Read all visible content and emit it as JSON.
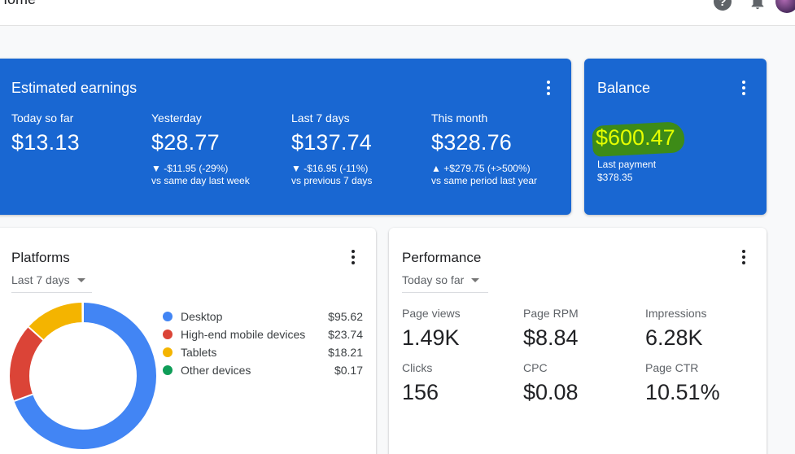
{
  "header": {
    "title": "Home"
  },
  "estimated_earnings": {
    "title": "Estimated earnings",
    "periods": [
      {
        "label": "Today so far",
        "value": "$13.13",
        "delta": "",
        "compare": ""
      },
      {
        "label": "Yesterday",
        "value": "$28.77",
        "delta": "▼ -$11.95 (-29%)",
        "compare": "vs same day last week"
      },
      {
        "label": "Last 7 days",
        "value": "$137.74",
        "delta": "▼ -$16.95 (-11%)",
        "compare": "vs previous 7 days"
      },
      {
        "label": "This month",
        "value": "$328.76",
        "delta": "▲ +$279.75 (+>500%)",
        "compare": "vs same period last year"
      }
    ]
  },
  "balance": {
    "title": "Balance",
    "value": "$600.47",
    "last_payment_label": "Last payment",
    "last_payment_value": "$378.35",
    "highlight_color": "#3d8b17",
    "value_color": "#e6ff00"
  },
  "platforms": {
    "title": "Platforms",
    "range": "Last 7 days",
    "items": [
      {
        "name": "Desktop",
        "value": "$95.62",
        "amount": 95.62,
        "color": "#4285f4"
      },
      {
        "name": "High-end mobile devices",
        "value": "$23.74",
        "amount": 23.74,
        "color": "#db4437"
      },
      {
        "name": "Tablets",
        "value": "$18.21",
        "amount": 18.21,
        "color": "#f4b400"
      },
      {
        "name": "Other devices",
        "value": "$0.17",
        "amount": 0.17,
        "color": "#0f9d58"
      }
    ]
  },
  "performance": {
    "title": "Performance",
    "range": "Today so far",
    "metrics": [
      {
        "label": "Page views",
        "value": "1.49K"
      },
      {
        "label": "Page RPM",
        "value": "$8.84"
      },
      {
        "label": "Impressions",
        "value": "6.28K"
      },
      {
        "label": "Clicks",
        "value": "156"
      },
      {
        "label": "CPC",
        "value": "$0.08"
      },
      {
        "label": "Page CTR",
        "value": "10.51%"
      }
    ]
  },
  "colors": {
    "card_blue": "#1967d2",
    "background": "#f8f9fa"
  },
  "icons": [
    "help-icon",
    "bell-icon",
    "avatar",
    "more-vert-icon",
    "dropdown-caret-icon"
  ]
}
